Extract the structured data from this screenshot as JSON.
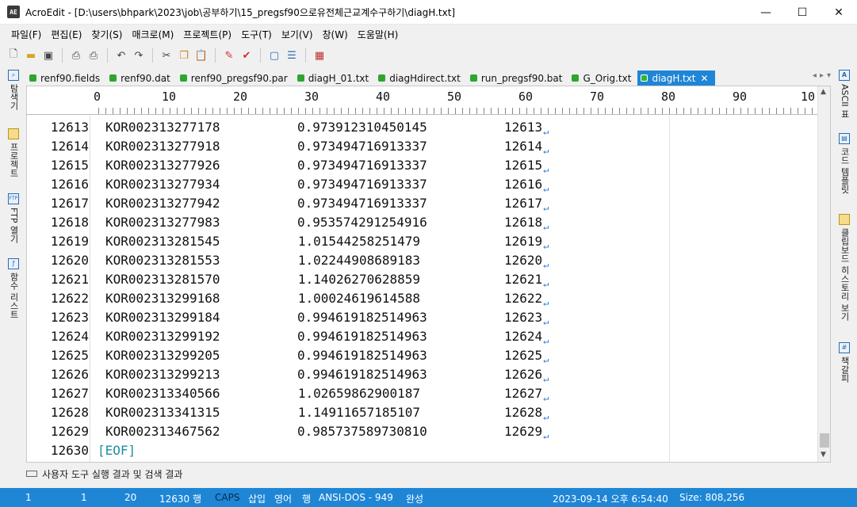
{
  "window": {
    "title": "AcroEdit - [D:\\users\\bhpark\\2023\\job\\공부하기\\15_pregsf90으로유전체근교계수구하기\\diagH.txt]",
    "app_icon_text": "AE",
    "minimize": "—",
    "maximize": "☐",
    "close": "✕"
  },
  "menu": [
    "파일(F)",
    "편집(E)",
    "찾기(S)",
    "매크로(M)",
    "프로젝트(P)",
    "도구(T)",
    "보기(V)",
    "창(W)",
    "도움말(H)"
  ],
  "toolbar_icons": [
    "new-file-icon",
    "open-folder-icon",
    "save-icon",
    "print-preview-icon",
    "print-icon",
    "undo-icon",
    "redo-icon",
    "cut-icon",
    "copy-icon",
    "paste-icon",
    "marker-icon",
    "check-icon",
    "window-icon",
    "list-icon",
    "calc-icon"
  ],
  "left_panel": [
    "탐색기",
    "프로젝트",
    "FTP 열기",
    "함수 리스트"
  ],
  "right_panel": [
    "ASCII 표",
    "코드 템플릿",
    "클립보드 히스토리 보기",
    "책갈피"
  ],
  "tabs": [
    {
      "label": "renf90.fields"
    },
    {
      "label": "renf90.dat"
    },
    {
      "label": "renf90_pregsf90.par"
    },
    {
      "label": "diagH_01.txt"
    },
    {
      "label": "diagHdirect.txt"
    },
    {
      "label": "run_pregsf90.bat"
    },
    {
      "label": "G_Orig.txt"
    },
    {
      "label": "diagH.txt",
      "active": true
    }
  ],
  "ruler": [
    "0",
    "10",
    "20",
    "30",
    "40",
    "50",
    "60",
    "70",
    "80",
    "90",
    "10"
  ],
  "lines": [
    {
      "ln": "12613",
      "code": "KOR002313277178",
      "val": "0.973912310450145",
      "idx": "12613"
    },
    {
      "ln": "12614",
      "code": "KOR002313277918",
      "val": "0.973494716913337",
      "idx": "12614"
    },
    {
      "ln": "12615",
      "code": "KOR002313277926",
      "val": "0.973494716913337",
      "idx": "12615"
    },
    {
      "ln": "12616",
      "code": "KOR002313277934",
      "val": "0.973494716913337",
      "idx": "12616"
    },
    {
      "ln": "12617",
      "code": "KOR002313277942",
      "val": "0.973494716913337",
      "idx": "12617"
    },
    {
      "ln": "12618",
      "code": "KOR002313277983",
      "val": "0.953574291254916",
      "idx": "12618"
    },
    {
      "ln": "12619",
      "code": "KOR002313281545",
      "val": "1.01544258251479",
      "idx": "12619"
    },
    {
      "ln": "12620",
      "code": "KOR002313281553",
      "val": "1.02244908689183",
      "idx": "12620"
    },
    {
      "ln": "12621",
      "code": "KOR002313281570",
      "val": "1.14026270628859",
      "idx": "12621"
    },
    {
      "ln": "12622",
      "code": "KOR002313299168",
      "val": "1.00024619614588",
      "idx": "12622"
    },
    {
      "ln": "12623",
      "code": "KOR002313299184",
      "val": "0.994619182514963",
      "idx": "12623"
    },
    {
      "ln": "12624",
      "code": "KOR002313299192",
      "val": "0.994619182514963",
      "idx": "12624"
    },
    {
      "ln": "12625",
      "code": "KOR002313299205",
      "val": "0.994619182514963",
      "idx": "12625"
    },
    {
      "ln": "12626",
      "code": "KOR002313299213",
      "val": "0.994619182514963",
      "idx": "12626"
    },
    {
      "ln": "12627",
      "code": "KOR002313340566",
      "val": "1.02659862900187",
      "idx": "12627"
    },
    {
      "ln": "12628",
      "code": "KOR002313341315",
      "val": "1.14911657185107",
      "idx": "12628"
    },
    {
      "ln": "12629",
      "code": "KOR002313467562",
      "val": "0.985737589730810",
      "idx": "12629"
    }
  ],
  "eof_line": {
    "ln": "12630",
    "text": "[EOF]"
  },
  "eol_mark": "↵",
  "output_panel": {
    "label": "사용자 도구 실행 결과 및 검색 결과"
  },
  "status": {
    "col1": "1",
    "col2": "1",
    "col3": "20",
    "lines": "12630 행",
    "caps": "CAPS",
    "insert": "삽입",
    "lang": "영어",
    "row": "행",
    "encoding": "ANSI-DOS - 949",
    "state": "완성",
    "datetime": "2023-09-14 오후 6:54:40",
    "size": "Size: 808,256"
  }
}
